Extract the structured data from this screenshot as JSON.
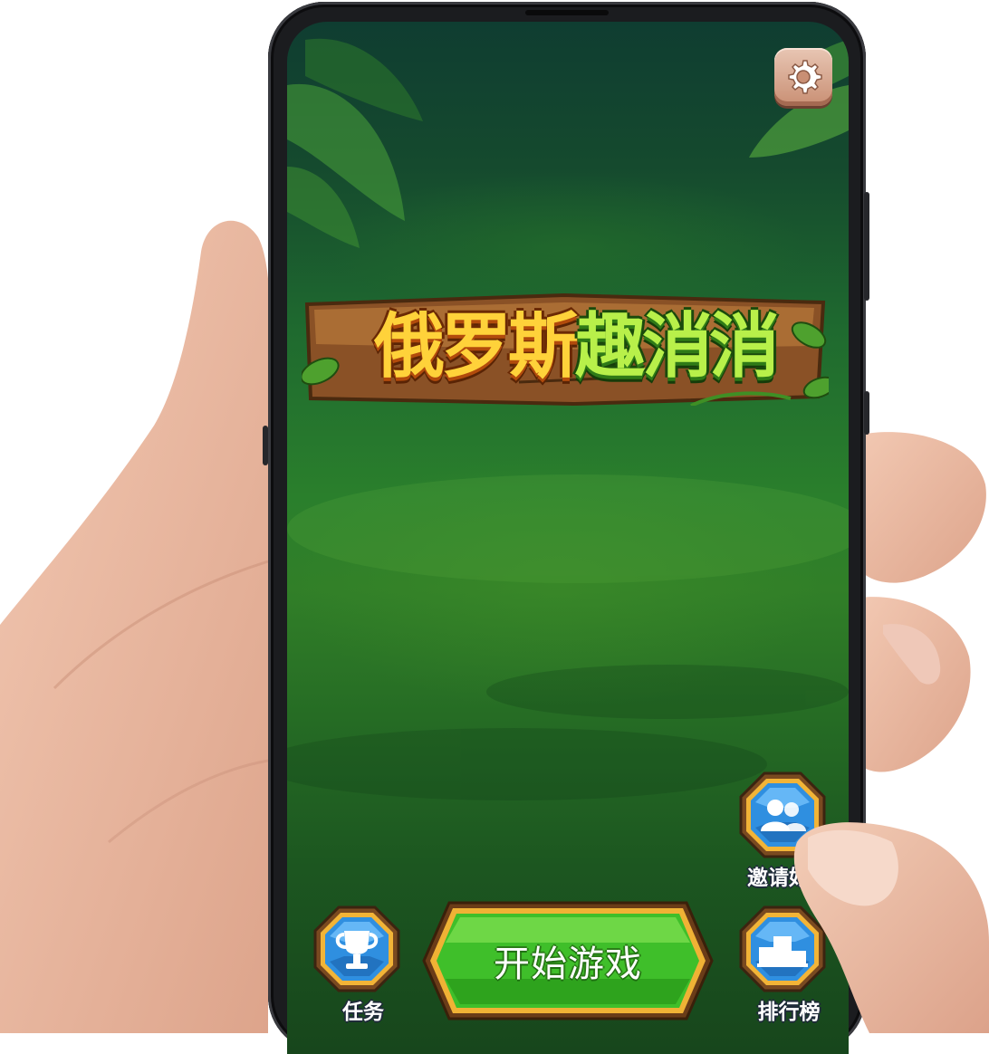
{
  "game": {
    "title_part1": "俄罗斯",
    "title_part2": "趣消消"
  },
  "buttons": {
    "start": "开始游戏",
    "tasks": "任务",
    "invite": "邀请好友",
    "leaderboard": "排行榜"
  },
  "icons": {
    "settings": "gear-icon",
    "tasks": "trophy-icon",
    "invite": "people-icon",
    "leaderboard": "podium-icon"
  },
  "colors": {
    "background": "#1f6a2f",
    "start_button": "#3fbf2a",
    "gem_button": "#2f8fe0",
    "settings_button": "#c98f74"
  }
}
